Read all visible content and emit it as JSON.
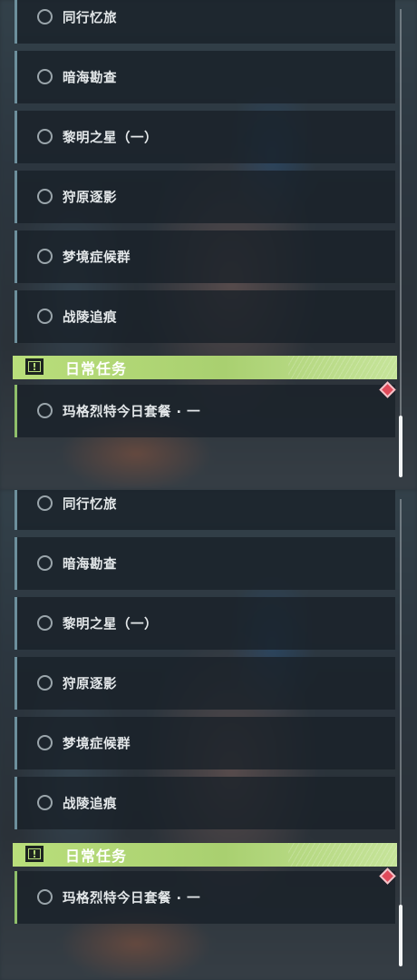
{
  "quest_items": [
    {
      "label": "同行忆旅"
    },
    {
      "label": "暗海勘查"
    },
    {
      "label": "黎明之星（一）"
    },
    {
      "label": "狩原逐影"
    },
    {
      "label": "梦境症候群"
    },
    {
      "label": "战陵追痕"
    }
  ],
  "daily_section": {
    "title": "日常任务",
    "icon": "exclamation-icon"
  },
  "daily_items": [
    {
      "label": "玛格烈特今日套餐 · 一",
      "has_new_badge": true
    }
  ],
  "colors": {
    "category_bar": "#b9de7b",
    "badge": "#e04a5a",
    "item_accent": "#6d8f9c"
  }
}
